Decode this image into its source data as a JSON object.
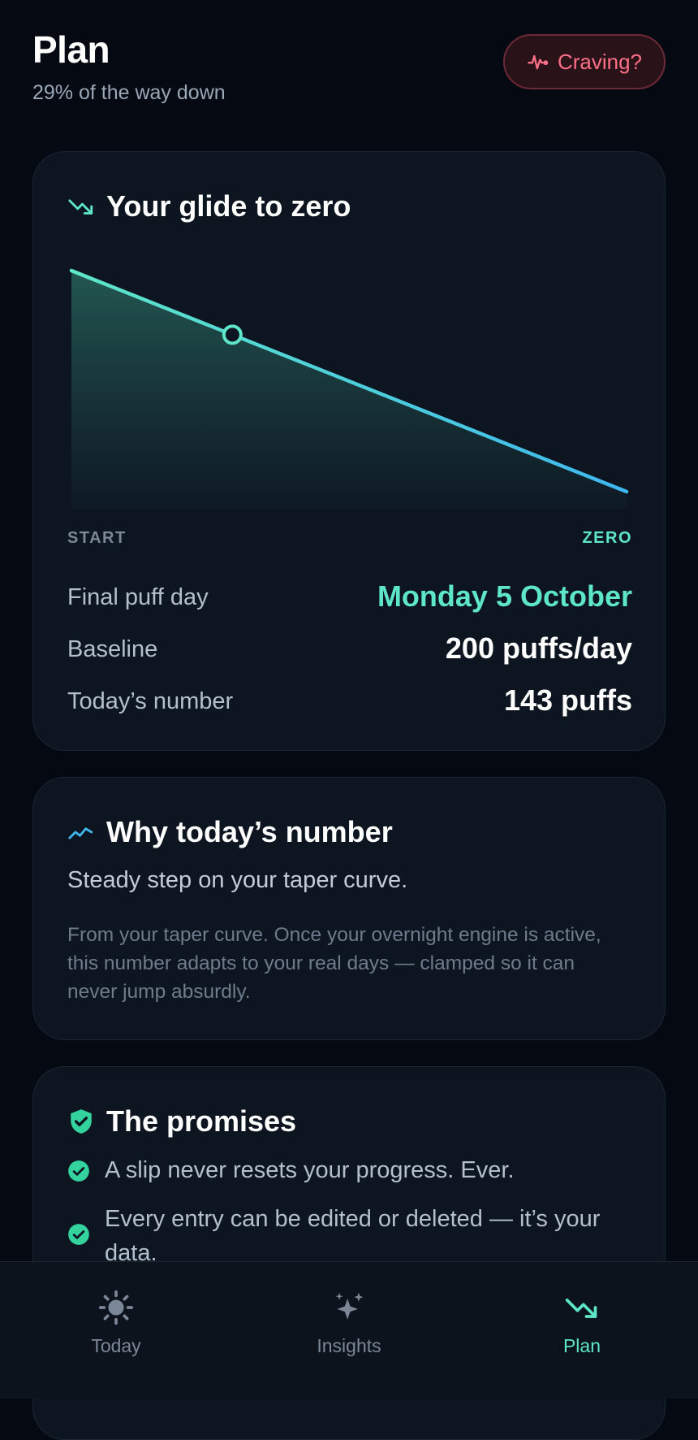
{
  "header": {
    "title": "Plan",
    "subtitle": "29% of the way down",
    "craving_label": "Craving?"
  },
  "glide": {
    "title": "Your glide to zero",
    "start_label": "START",
    "end_label": "ZERO",
    "today_progress_fraction": 0.29,
    "rows": [
      {
        "label": "Final puff day",
        "value": "Monday 5 October"
      },
      {
        "label": "Baseline",
        "value": "200 puffs/day"
      },
      {
        "label": "Today’s number",
        "value": "143 puffs"
      }
    ]
  },
  "why": {
    "title": "Why today’s number",
    "lead": "Steady step on your taper curve.",
    "body": "From your taper curve. Once your overnight engine is active, this number adapts to your real days — clamped so it can never jump absurdly."
  },
  "promises": {
    "title": "The promises",
    "items": [
      "A slip never resets your progress. Ever.",
      "Every entry can be edited or deleted — it’s your data."
    ]
  },
  "nav": {
    "items": [
      {
        "label": "Today",
        "icon": "sun-icon"
      },
      {
        "label": "Insights",
        "icon": "sparkles-icon"
      },
      {
        "label": "Plan",
        "icon": "trending-down-icon"
      }
    ],
    "active": "Plan"
  },
  "colors": {
    "accent": "#5ee6c8",
    "accent_blue": "#3eb8ee",
    "craving": "#ff6f86",
    "background": "#050a12",
    "card": "#0d1520"
  }
}
